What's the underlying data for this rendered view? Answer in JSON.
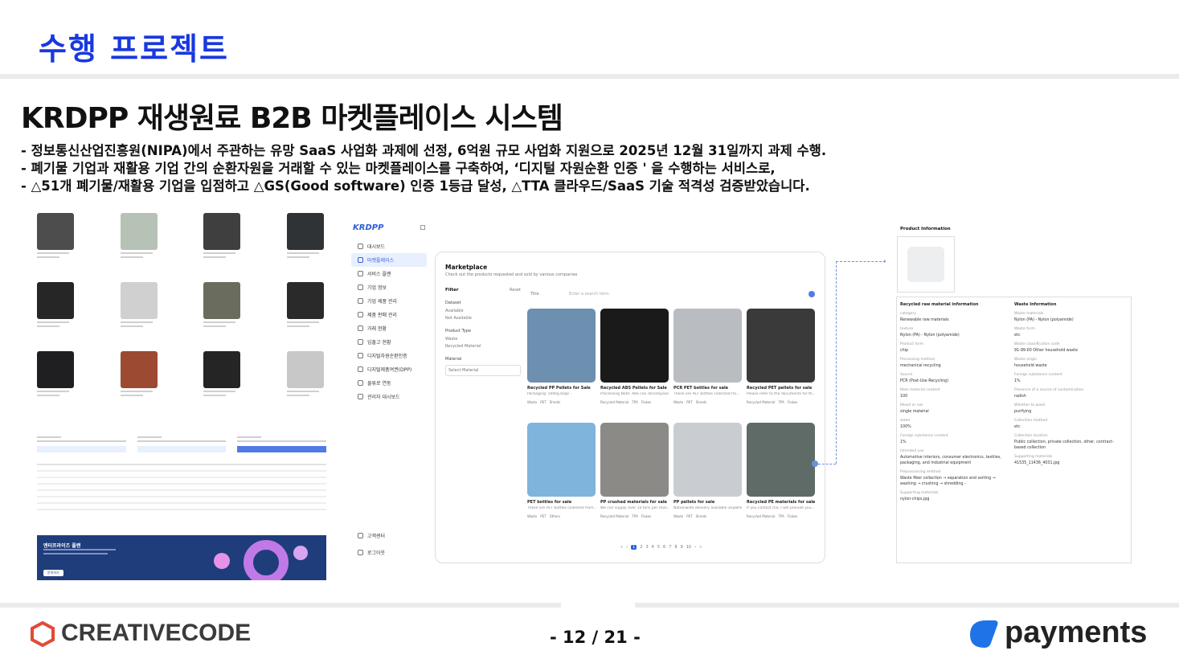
{
  "header": {
    "title": "수행 프로젝트"
  },
  "slide": {
    "title": "KRDPP 재생원료 B2B 마켓플레이스 시스템",
    "bullets": [
      "-  정보통신산업진흥원(NIPA)에서 주관하는 유망 SaaS 사업화 과제에 선정, 6억원 규모 사업화 지원으로 2025년 12월 31일까지 과제 수행.",
      "-  폐기물 기업과 재활용 기업 간의 순환자원을 거래할 수 있는 마켓플레이스를 구축하여,   ‘디지털 자원순환 인증 ' 을 수행하는 서비스로,",
      "-  △51개 폐기물/재활용 기업을 입점하고 △GS(Good software) 인증 1등급 달성, △TTA 클라우드/SaaS 기술 적격성 검증받았습니다."
    ]
  },
  "left_shot": {
    "banner_title": "엔터프라이즈 플랜",
    "banner_button": "문의하기"
  },
  "app": {
    "logo": "KRDPP",
    "sidebar": [
      {
        "label": "대시보드",
        "icon": "home-icon"
      },
      {
        "label": "마켓플레이스",
        "icon": "market-icon"
      },
      {
        "label": "서비스 플랜",
        "icon": "plan-icon"
      },
      {
        "label": "기업 정보",
        "icon": "building-icon"
      },
      {
        "label": "기업 제품 관리",
        "icon": "box-icon"
      },
      {
        "label": "제품 판매 관리",
        "icon": "tag-icon"
      },
      {
        "label": "거래 현황",
        "icon": "chart-icon"
      },
      {
        "label": "입출고 현황",
        "icon": "truck-icon"
      },
      {
        "label": "디지털자원순환인증",
        "icon": "cert-icon"
      },
      {
        "label": "디지털제품여권(DPP)",
        "icon": "passport-icon"
      },
      {
        "label": "물류로 연동",
        "icon": "link-icon"
      },
      {
        "label": "관리자 대시보드",
        "icon": "admin-icon"
      }
    ],
    "sidebar_bottom": [
      "고객센터",
      "로그아웃"
    ]
  },
  "marketplace": {
    "title": "Marketplace",
    "subtitle": "Check out the products requested and sold by various companies",
    "filter_label": "Filter",
    "reset_label": "Reset",
    "dataset_label": "Dataset",
    "dataset_options": [
      "Available",
      "Not Available"
    ],
    "product_type_label": "Product Type",
    "product_type_options": [
      "Waste",
      "Recycled Material"
    ],
    "material_label": "Material",
    "material_placeholder": "Select Material",
    "search_field": "Title",
    "search_placeholder": "Enter a search term",
    "cards": [
      {
        "title": "Recycled PP Pellets for Sale",
        "desc": "Packaging: 500kg bags -",
        "tags": [
          "Waste",
          "PET",
          "Shreds"
        ],
        "color": "#6d8fb0"
      },
      {
        "title": "Recycled ABS Pellets for Sale",
        "desc": "Processing Note: ABS can decompose -",
        "tags": [
          "Recycled Material",
          "TPA",
          "Flakes"
        ],
        "color": "#1a1a1a"
      },
      {
        "title": "PCR PET bottles for sale",
        "desc": "These are PET bottles collected fro...",
        "tags": [
          "Waste",
          "PET",
          "Shreds"
        ],
        "color": "#b9bcc0"
      },
      {
        "title": "Recycled PET pellets for sale",
        "desc": "Please refer to the documents for th...",
        "tags": [
          "Recycled Material",
          "TPA",
          "Flakes"
        ],
        "color": "#3a3a3a"
      },
      {
        "title": "PET bottles for sale",
        "desc": "These are PET bottles collected from...",
        "tags": [
          "Waste",
          "PET",
          "Others"
        ],
        "color": "#7fb4dc"
      },
      {
        "title": "PP crushed materials for sale",
        "desc": "We can supply over 10 tons per mon...",
        "tags": [
          "Recycled Material",
          "TPA",
          "Flakes"
        ],
        "color": "#8c8a86"
      },
      {
        "title": "PP pellets for sale",
        "desc": "Nationwide delivery available anywhere",
        "tags": [
          "Waste",
          "PET",
          "Shreds"
        ],
        "color": "#c9ccd0"
      },
      {
        "title": "Recycled PE materials for sale",
        "desc": "If you contact me, I will provide you...",
        "tags": [
          "Recycled Material",
          "TPA",
          "Flakes"
        ],
        "color": "#5f6b66"
      }
    ],
    "pagination": [
      "«",
      "‹",
      "1",
      "2",
      "3",
      "4",
      "5",
      "6",
      "7",
      "8",
      "9",
      "10",
      "›",
      "»"
    ]
  },
  "product_info": {
    "label": "Product Information",
    "left_heading": "Recycled raw material information",
    "right_heading": "Waste Information",
    "left_fields": [
      {
        "k": "category",
        "v": "Renewable raw materials"
      },
      {
        "k": "texture",
        "v": "Nylon (PA) - Nylon (polyamide)"
      },
      {
        "k": "Product form",
        "v": "chip"
      },
      {
        "k": "Processing method",
        "v": "mechanical recycling"
      },
      {
        "k": "Source",
        "v": "PCR (Post-Use Recycling)"
      },
      {
        "k": "Main material content",
        "v": "100"
      },
      {
        "k": "Mixed or not",
        "v": "single material"
      },
      {
        "k": "water",
        "v": "100%"
      },
      {
        "k": "Foreign substance content",
        "v": "1%"
      },
      {
        "k": "Intended use",
        "v": "Automotive interiors, consumer electronics, textiles, packaging, and industrial equipment"
      },
      {
        "k": "Preprocessing method",
        "v": "Waste fiber collection → separation and sorting → washing → crushing → shredding -"
      },
      {
        "k": "Supporting materials",
        "v": "nylon-chips.jpg"
      }
    ],
    "right_fields": [
      {
        "k": "Waste materials",
        "v": "Nylon (PA) - Nylon (polyamide)"
      },
      {
        "k": "Waste form",
        "v": "etc"
      },
      {
        "k": "Waste classification code",
        "v": "91-99-00 Other household waste"
      },
      {
        "k": "Waste origin",
        "v": "household waste"
      },
      {
        "k": "Foreign substance content",
        "v": "1%"
      },
      {
        "k": "Presence of a source of contamination",
        "v": "radish"
      },
      {
        "k": "Whether to wash",
        "v": "purifying"
      },
      {
        "k": "Collection method",
        "v": "etc"
      },
      {
        "k": "Collection location",
        "v": "Public collection, private collection, other, contract-based collection"
      },
      {
        "k": "Supporting materials",
        "v": "41535_11436_4031.jpg"
      }
    ]
  },
  "footer": {
    "brand": "CREATIVECODE",
    "page": "- 12 / 21  -",
    "partner": "payments"
  },
  "colors": {
    "accent": "#1838e0",
    "app_blue": "#2f5fd6",
    "rule": "#ebebeb"
  }
}
